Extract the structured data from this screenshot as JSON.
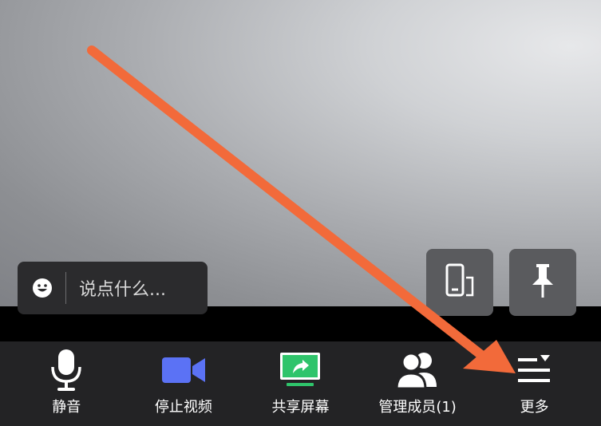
{
  "video": {
    "background": "#9fa1a5"
  },
  "chat": {
    "placeholder": "说点什么...",
    "icon": "smile-icon"
  },
  "float_buttons": [
    {
      "name": "switch-device-button",
      "icon": "phone-switch-icon"
    },
    {
      "name": "pin-button",
      "icon": "pin-icon"
    }
  ],
  "toolbar": {
    "items": [
      {
        "label": "静音",
        "icon": "microphone-icon"
      },
      {
        "label": "停止视频",
        "icon": "video-camera-icon",
        "color": "#5b72f5"
      },
      {
        "label": "共享屏幕",
        "icon": "share-screen-icon",
        "color": "#2fc46b"
      },
      {
        "label": "管理成员(1)",
        "icon": "participants-icon"
      },
      {
        "label": "更多",
        "icon": "more-menu-icon"
      }
    ]
  },
  "annotation": {
    "type": "arrow",
    "color": "#f26a3a"
  }
}
